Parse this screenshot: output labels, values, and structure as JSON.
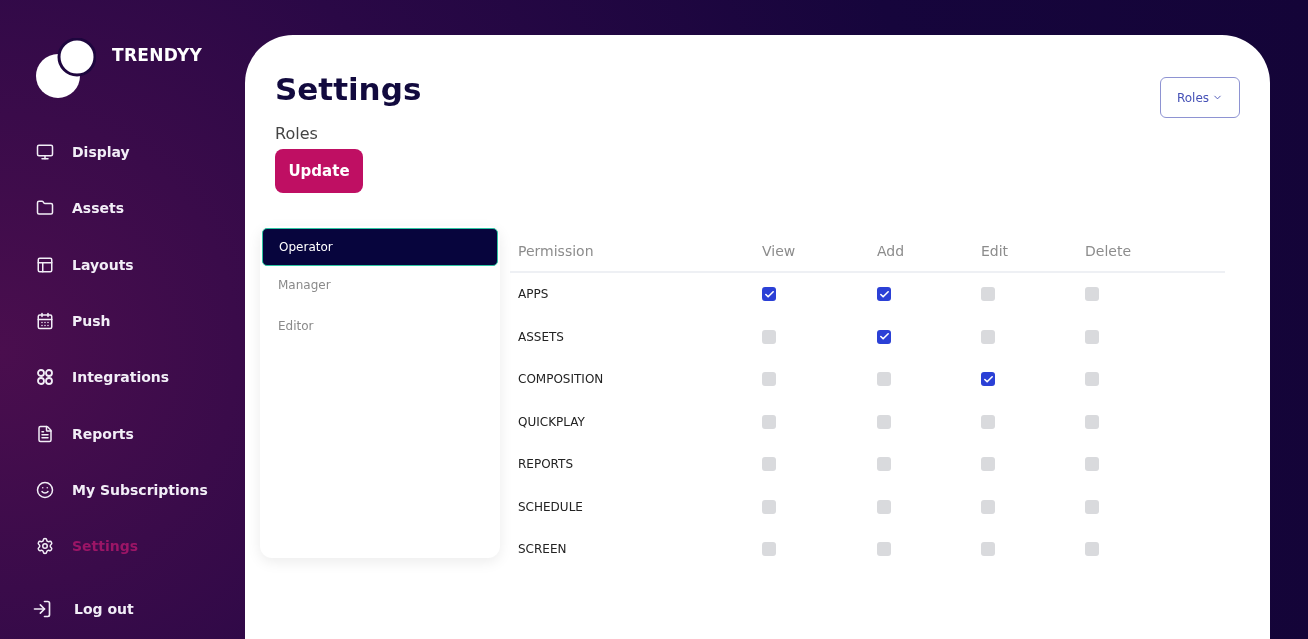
{
  "brand": "TRENDYY",
  "nav": [
    {
      "label": "Display",
      "selected": false
    },
    {
      "label": "Assets",
      "selected": false
    },
    {
      "label": "Layouts",
      "selected": false
    },
    {
      "label": "Push",
      "selected": false
    },
    {
      "label": "Integrations",
      "selected": false
    },
    {
      "label": "Reports",
      "selected": false
    },
    {
      "label": "My Subscriptions",
      "selected": false
    },
    {
      "label": "Settings",
      "selected": true
    }
  ],
  "logout": "Log out",
  "title": "Settings",
  "roles_dropdown": "Roles",
  "section_label": "Roles",
  "update_button": "Update",
  "roles": [
    {
      "label": "Operator",
      "selected": true
    },
    {
      "label": "Manager",
      "selected": false
    },
    {
      "label": "Editor",
      "selected": false
    }
  ],
  "columns": [
    "Permission",
    "View",
    "Add",
    "Edit",
    "Delete"
  ],
  "rows": [
    {
      "name": "APPS",
      "checks": [
        true,
        true,
        false,
        false
      ]
    },
    {
      "name": "ASSETS",
      "checks": [
        false,
        true,
        false,
        false
      ]
    },
    {
      "name": "COMPOSITION",
      "checks": [
        false,
        false,
        true,
        false
      ]
    },
    {
      "name": "QUICKPLAY",
      "checks": [
        false,
        false,
        false,
        false
      ]
    },
    {
      "name": "REPORTS",
      "checks": [
        false,
        false,
        false,
        false
      ]
    },
    {
      "name": "SCHEDULE",
      "checks": [
        false,
        false,
        false,
        false
      ]
    },
    {
      "name": "SCREEN",
      "checks": [
        false,
        false,
        false,
        false
      ]
    }
  ]
}
